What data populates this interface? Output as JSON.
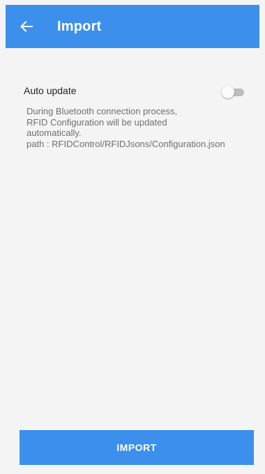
{
  "header": {
    "back_icon": "arrow-left-icon",
    "title": "Import"
  },
  "auto_update": {
    "label": "Auto update",
    "toggle_on": false,
    "description_lines": [
      "During Bluetooth connection process,",
      "RFID Configuration will be updated",
      "automatically.",
      "path : RFIDControl/RFIDJsons/Configuration.json"
    ]
  },
  "import_button": {
    "label": "IMPORT"
  },
  "colors": {
    "primary": "#3d8fec",
    "background": "#f4f4f4",
    "toggle_track_off": "#bdbdbd"
  }
}
